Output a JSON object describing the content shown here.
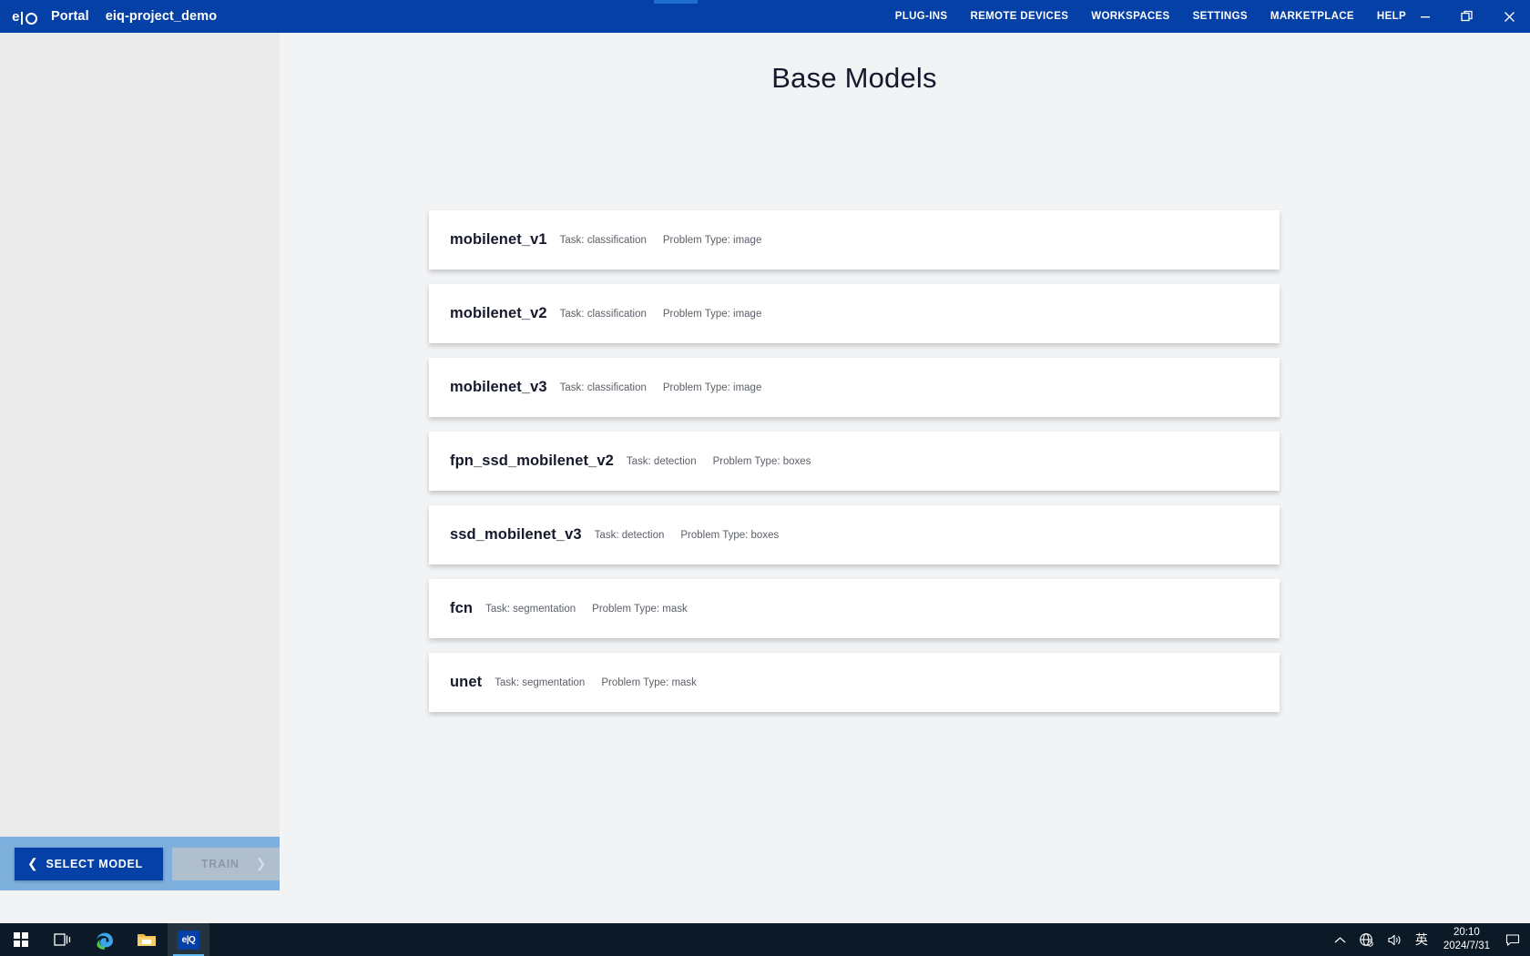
{
  "titlebar": {
    "logo": "eIQ-logo-icon",
    "portal_label": "Portal",
    "project_label": "eiq-project_demo",
    "nav": [
      {
        "label": "PLUG-INS",
        "name": "nav-plug-ins"
      },
      {
        "label": "REMOTE DEVICES",
        "name": "nav-remote-devices"
      },
      {
        "label": "WORKSPACES",
        "name": "nav-workspaces"
      },
      {
        "label": "SETTINGS",
        "name": "nav-settings"
      },
      {
        "label": "MARKETPLACE",
        "name": "nav-marketplace"
      },
      {
        "label": "HELP",
        "name": "nav-help"
      }
    ],
    "window_controls": {
      "minimize": "minimize-icon",
      "restore": "restore-icon",
      "close": "close-icon"
    }
  },
  "main": {
    "page_title": "Base Models",
    "models": [
      {
        "name": "mobilenet_v1",
        "task": "Task: classification",
        "problem": "Problem Type: image"
      },
      {
        "name": "mobilenet_v2",
        "task": "Task: classification",
        "problem": "Problem Type: image"
      },
      {
        "name": "mobilenet_v3",
        "task": "Task: classification",
        "problem": "Problem Type: image"
      },
      {
        "name": "fpn_ssd_mobilenet_v2",
        "task": "Task: detection",
        "problem": "Problem Type: boxes"
      },
      {
        "name": "ssd_mobilenet_v3",
        "task": "Task: detection",
        "problem": "Problem Type: boxes"
      },
      {
        "name": "fcn",
        "task": "Task: segmentation",
        "problem": "Problem Type: mask"
      },
      {
        "name": "unet",
        "task": "Task: segmentation",
        "problem": "Problem Type: mask"
      }
    ]
  },
  "sidebar": {
    "footer": {
      "back_chevron": "chevron-left-icon",
      "select_model_label": "SELECT MODEL",
      "train_label": "TRAIN",
      "forward_chevron": "chevron-right-icon"
    }
  },
  "taskbar": {
    "items": [
      {
        "name": "start-button",
        "icon": "windows-logo-icon"
      },
      {
        "name": "task-view-button",
        "icon": "task-view-icon"
      },
      {
        "name": "edge-button",
        "icon": "edge-browser-icon"
      },
      {
        "name": "file-explorer-button",
        "icon": "folder-icon"
      },
      {
        "name": "eiq-portal-button",
        "icon": "eIQ-app-icon",
        "label": "eIQ"
      }
    ],
    "tray": {
      "overflow": "chevron-up-icon",
      "network": "network-disconnected-icon",
      "volume": "volume-icon",
      "ime": "英",
      "time": "20:10",
      "date": "2024/7/31",
      "notifications": "notification-icon"
    }
  },
  "colors": {
    "brand_blue": "#0540a6",
    "top_stripe": "#1c6fd0",
    "sidebar_bg": "#eaeaea",
    "sidebar_footer": "#7db0dd",
    "content_bg": "#f1f3f5",
    "card_bg": "#ffffff",
    "disabled_btn": "#b0bfcd",
    "taskbar_bg": "#0b1a26"
  }
}
